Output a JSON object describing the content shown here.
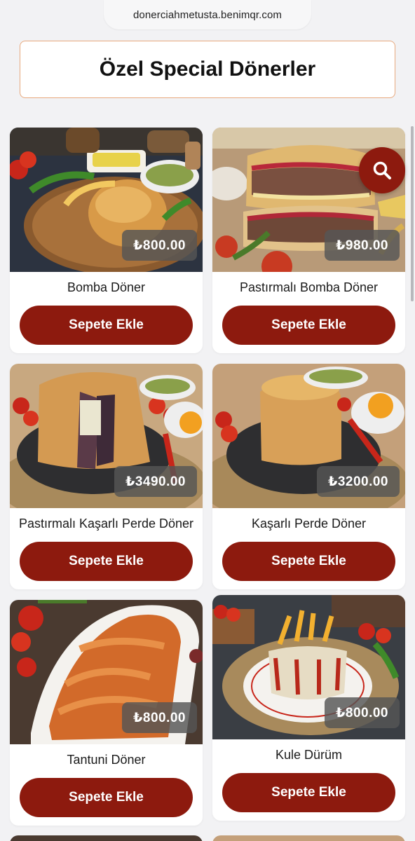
{
  "browser": {
    "url": "donerciahmetusta.benimqr.com"
  },
  "section": {
    "title": "Özel Special Dönerler"
  },
  "products": [
    {
      "name": "Bomba Döner",
      "price": "₺800.00",
      "button": "Sepete Ekle"
    },
    {
      "name": "Pastırmalı Bomba Döner",
      "price": "₺980.00",
      "button": "Sepete Ekle"
    },
    {
      "name": "Pastırmalı Kaşarlı Perde Döner",
      "price": "₺3490.00",
      "button": "Sepete Ekle"
    },
    {
      "name": "Kaşarlı Perde Döner",
      "price": "₺3200.00",
      "button": "Sepete Ekle"
    },
    {
      "name": "Tantuni Döner",
      "price": "₺800.00",
      "button": "Sepete Ekle"
    },
    {
      "name": "Kule Dürüm",
      "price": "₺800.00",
      "button": "Sepete Ekle"
    }
  ],
  "icons": {
    "search": "search-icon"
  },
  "colors": {
    "accent": "#8d1a0e",
    "heading_border": "#e8a87c",
    "price_badge": "#555555"
  }
}
